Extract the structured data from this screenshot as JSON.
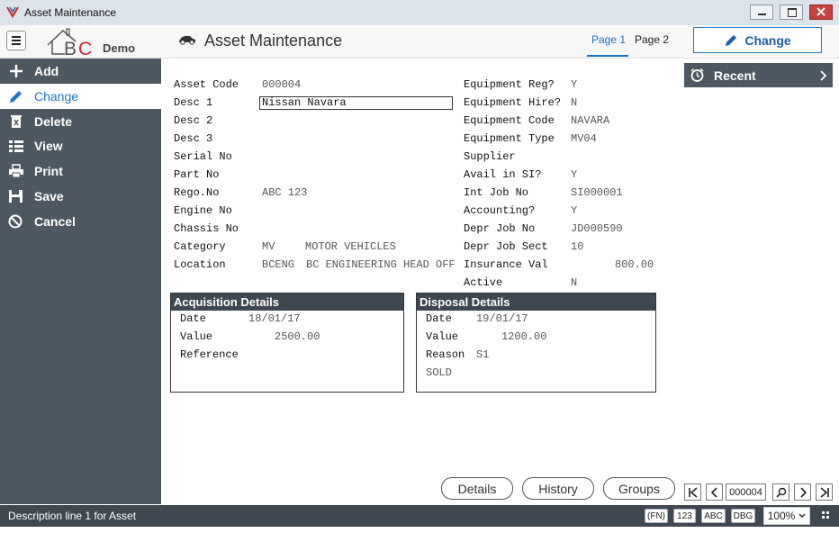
{
  "window": {
    "title": "Asset Maintenance"
  },
  "header": {
    "logo_text": "BC",
    "logo_sub": "Demo",
    "title": "Asset Maintenance",
    "tabs": [
      "Page 1",
      "Page 2"
    ],
    "change_label": "Change"
  },
  "sidebar": {
    "items": [
      {
        "label": "Add"
      },
      {
        "label": "Change"
      },
      {
        "label": "Delete"
      },
      {
        "label": "View"
      },
      {
        "label": "Print"
      },
      {
        "label": "Save"
      },
      {
        "label": "Cancel"
      }
    ]
  },
  "form": {
    "left": {
      "asset_code": {
        "label": "Asset Code",
        "value": "000004"
      },
      "desc1": {
        "label": "Desc 1",
        "value": "Nissan Navara"
      },
      "desc2": {
        "label": "Desc 2"
      },
      "desc3": {
        "label": "Desc 3"
      },
      "serial_no": {
        "label": "Serial No"
      },
      "part_no": {
        "label": "Part No"
      },
      "rego_no": {
        "label": "Rego.No",
        "value": "ABC 123"
      },
      "engine_no": {
        "label": "Engine No"
      },
      "chassis_no": {
        "label": "Chassis No"
      },
      "category": {
        "label": "Category",
        "code": "MV",
        "desc": "MOTOR VEHICLES"
      },
      "location": {
        "label": "Location",
        "code": "BCENG",
        "desc": "BC ENGINEERING HEAD OFF"
      }
    },
    "right": {
      "equipment_reg": {
        "label": "Equipment Reg?",
        "value": "Y"
      },
      "equipment_hire": {
        "label": "Equipment Hire?",
        "value": "N"
      },
      "equipment_code": {
        "label": "Equipment Code",
        "value": "NAVARA"
      },
      "equipment_type": {
        "label": "Equipment Type",
        "value": "MV04"
      },
      "supplier": {
        "label": "Supplier"
      },
      "avail_in_si": {
        "label": "Avail in SI?",
        "value": "Y"
      },
      "int_job_no": {
        "label": "Int Job No",
        "value": "SI000001"
      },
      "accounting": {
        "label": "Accounting?",
        "value": "Y"
      },
      "depr_job_no": {
        "label": "Depr Job No",
        "value": "JD000590"
      },
      "depr_job_sect": {
        "label": "Depr Job Sect",
        "value": "10"
      },
      "insurance_val": {
        "label": "Insurance Val",
        "value": "800.00"
      },
      "active": {
        "label": "Active",
        "value": "N"
      }
    }
  },
  "acquisition": {
    "title": "Acquisition Details",
    "date": {
      "label": "Date",
      "value": "18/01/17"
    },
    "value": {
      "label": "Value",
      "value": "2500.00"
    },
    "reference": {
      "label": "Reference"
    }
  },
  "disposal": {
    "title": "Disposal Details",
    "date": {
      "label": "Date",
      "value": "19/01/17"
    },
    "value": {
      "label": "Value",
      "value": "1200.00"
    },
    "reason": {
      "label": "Reason",
      "value": "S1"
    },
    "reason_desc": "SOLD"
  },
  "recent": {
    "label": "Recent"
  },
  "bottom_buttons": [
    "Details",
    "History",
    "Groups"
  ],
  "nav": {
    "record": "000004"
  },
  "status": {
    "text": "Description line 1 for Asset",
    "badges": [
      "(FN)",
      "123",
      "ABC",
      "DBG"
    ],
    "zoom": "100%"
  },
  "colors": {
    "accent": "#1a73c8",
    "sidebar": "#4d5863",
    "header_dark": "#3f4851"
  }
}
